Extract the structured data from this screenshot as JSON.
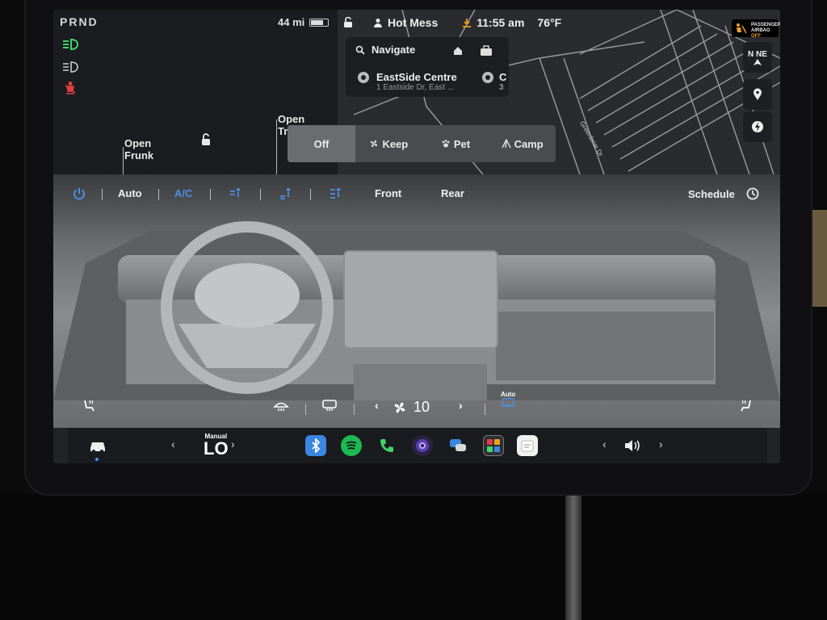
{
  "gear": "PRND",
  "range": "44 mi",
  "user": "Hot Mess",
  "time": "11:55 am",
  "temperature": "76°F",
  "airbag": {
    "line1": "PASSENGER",
    "line2": "AIRBAG",
    "status": "OFF"
  },
  "compass": {
    "heading": "N NE"
  },
  "navigation": {
    "search_label": "Navigate",
    "destination": {
      "title": "EastSide Centre",
      "subtitle": "1 Eastside Dr, East ..."
    },
    "destination2_initial": "C",
    "destination2_sub": "3"
  },
  "map": {
    "street": "Greenbriar Dr"
  },
  "car": {
    "frunk_label_1": "Open",
    "frunk_label_2": "Frunk",
    "trunk_label_1": "Open",
    "trunk_label_2": "Trunk"
  },
  "climate_mode": {
    "options": [
      {
        "label": "Off",
        "active": true
      },
      {
        "label": "Keep",
        "active": false
      },
      {
        "label": "Pet",
        "active": false
      },
      {
        "label": "Camp",
        "active": false
      }
    ]
  },
  "climate": {
    "auto_label": "Auto",
    "ac_label": "A/C",
    "front_label": "Front",
    "rear_label": "Rear",
    "schedule_label": "Schedule",
    "fan_speed": "10",
    "recirc_label": "Auto"
  },
  "dock": {
    "temp_mode": "Manual",
    "temp_value": "LO"
  },
  "colors": {
    "accent": "#4a90e8",
    "dock_bg": "#1a1b1e",
    "screen_bg": "#222326"
  }
}
